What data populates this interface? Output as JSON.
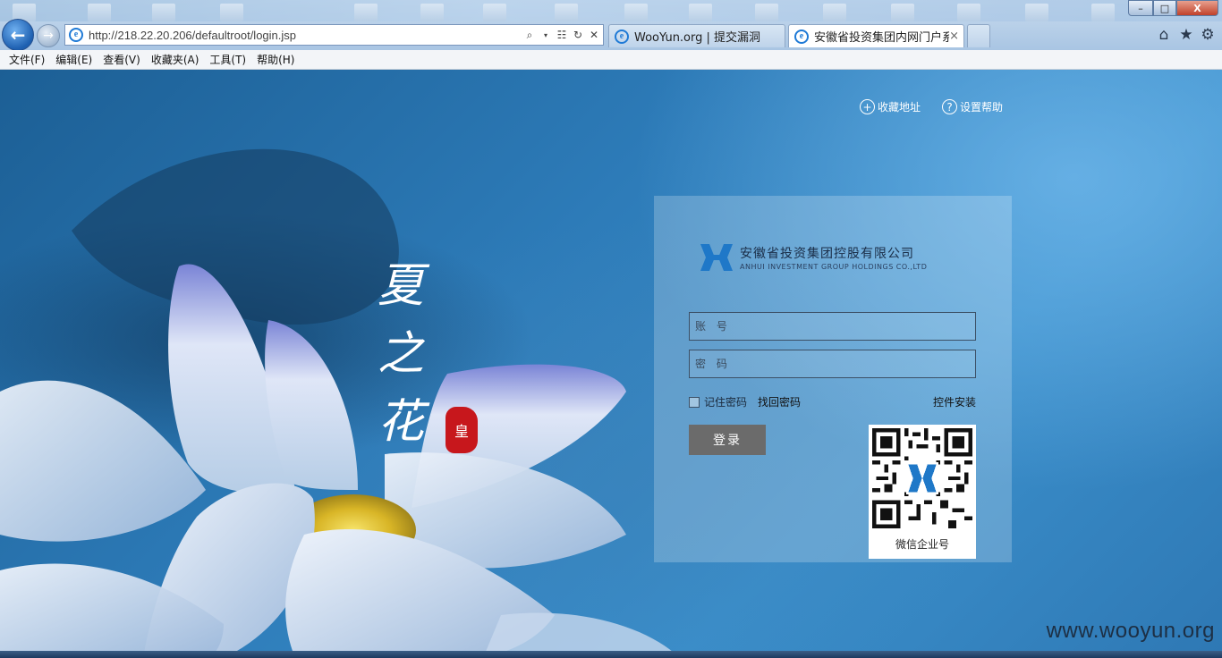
{
  "browser": {
    "address": "http://218.22.20.206/defaultroot/login.jsp",
    "tabs": [
      {
        "label": "WooYun.org | 提交漏洞"
      },
      {
        "label": "安徽省投资集团内网门户系统"
      }
    ],
    "tab_close": "×",
    "window_buttons": {
      "minimize": "–",
      "maximize": "□",
      "close": "X"
    },
    "toolbar_icons": [
      "home-icon",
      "star-icon",
      "gear-icon"
    ]
  },
  "menu": {
    "items": [
      "文件(F)",
      "编辑(E)",
      "查看(V)",
      "收藏夹(A)",
      "工具(T)",
      "帮助(H)"
    ]
  },
  "page": {
    "calligraphy": [
      "夏",
      "之",
      "花"
    ],
    "seal_text": "皇",
    "top_links": {
      "favorite": "收藏地址",
      "help": "设置帮助"
    },
    "login": {
      "company_cn": "安徽省投资集团控股有限公司",
      "company_en": "ANHUI INVESTMENT GROUP HOLDINGS CO.,LTD",
      "username_placeholder": "账 号",
      "password_placeholder": "密 码",
      "remember_label": "记住密码",
      "forgot_label": "找回密码",
      "plugin_label": "控件安装",
      "login_button": "登录",
      "qr_label": "微信企业号"
    },
    "watermark": "www.wooyun.org"
  },
  "colors": {
    "accent": "#1f7ad6",
    "background": "#2d7bb8",
    "login_button": "#6b6b6b",
    "seal": "#c7171c"
  }
}
